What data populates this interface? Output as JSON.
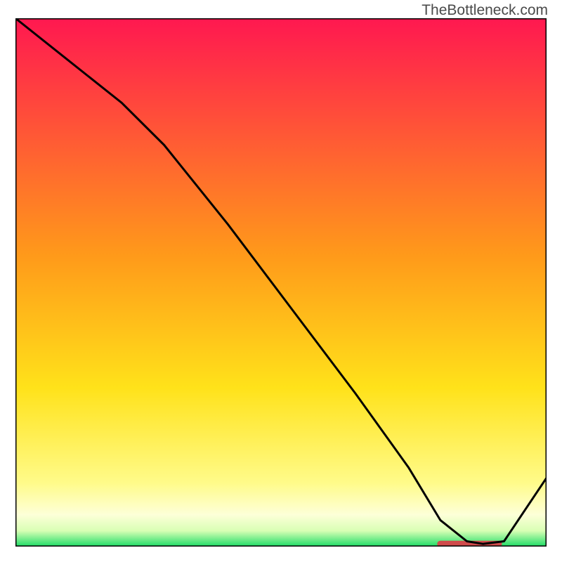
{
  "watermark": "TheBottleneck.com",
  "chart_data": {
    "type": "line",
    "title": "",
    "xlabel": "",
    "ylabel": "",
    "xlim": [
      0,
      100
    ],
    "ylim": [
      0,
      100
    ],
    "background": "rainbow-gradient-vertical",
    "series": [
      {
        "name": "curve",
        "color": "#000000",
        "x": [
          0,
          10,
          20,
          28,
          40,
          52,
          64,
          74,
          80,
          85,
          88,
          92,
          100
        ],
        "y": [
          100,
          92,
          84,
          76,
          61,
          45,
          29,
          15,
          5,
          1,
          0.5,
          1,
          13
        ]
      }
    ],
    "annotations": [
      {
        "name": "bottleneck-marker",
        "type": "segment",
        "x0": 80,
        "x1": 91,
        "y": 0.5,
        "color": "#d04b4b"
      }
    ],
    "gradient_stops": [
      {
        "offset": 0,
        "color": "#ff1850"
      },
      {
        "offset": 0.45,
        "color": "#ff9a1a"
      },
      {
        "offset": 0.7,
        "color": "#ffe21a"
      },
      {
        "offset": 0.88,
        "color": "#fffb8a"
      },
      {
        "offset": 0.94,
        "color": "#fdffd8"
      },
      {
        "offset": 0.97,
        "color": "#d9ffb5"
      },
      {
        "offset": 1.0,
        "color": "#1ddc66"
      }
    ]
  }
}
